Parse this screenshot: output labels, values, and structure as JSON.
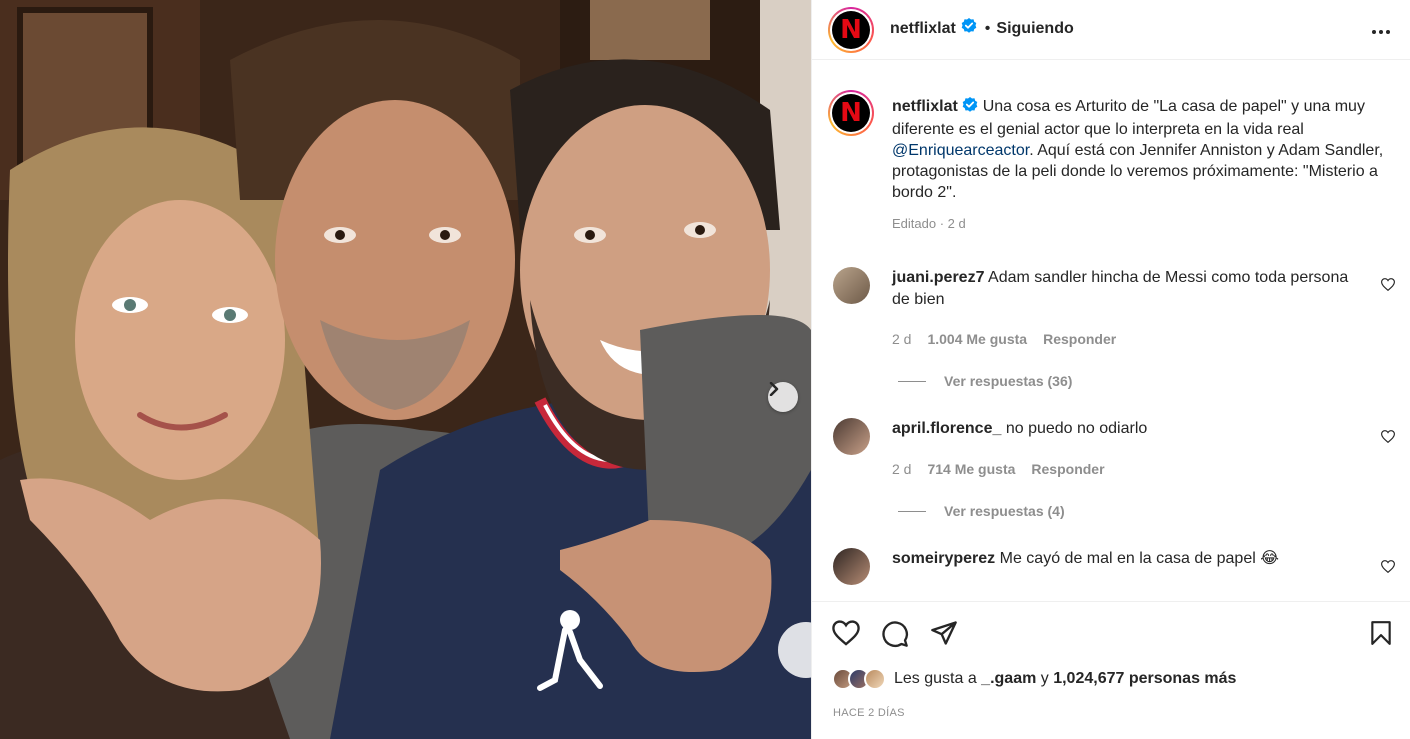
{
  "post": {
    "account": "netflixlat",
    "follow_status": "Siguiendo",
    "dot": "•",
    "logo_letter": "N",
    "caption_text_1": "Una cosa es Arturito de \"La casa de papel\" y una muy diferente es el genial actor que lo interpreta en la vida real ",
    "caption_mention": "@Enriquearceactor",
    "caption_text_2": ". Aquí está con Jennifer Anniston y Adam Sandler, protagonistas de la peli donde lo veremos próximamente: \"Misterio a bordo 2\".",
    "caption_meta": "Editado · 2 d"
  },
  "comments": [
    {
      "user": "juani.perez7",
      "text": "Adam sandler hincha de Messi como toda persona de bien",
      "time": "2 d",
      "likes": "1.004 Me gusta",
      "reply": "Responder",
      "view_replies": "Ver respuestas (36)"
    },
    {
      "user": "april.florence_",
      "text": "no puedo no odiarlo",
      "time": "2 d",
      "likes": "714 Me gusta",
      "reply": "Responder",
      "view_replies": "Ver respuestas (4)"
    },
    {
      "user": "someiryperez",
      "text": "Me cayó de mal en la casa de papel",
      "emoji": "😂"
    }
  ],
  "footer": {
    "likes_prefix": "Les gusta a ",
    "likes_user": "_.gaam",
    "likes_middle": " y ",
    "likes_count": "1,024,677 personas más",
    "date": "HACE 2 DÍAS"
  },
  "colors": {
    "brand_red": "#e50914",
    "verified_blue": "#0095f6",
    "mention_blue": "#00376b",
    "muted_gray": "#8e8e8e"
  }
}
